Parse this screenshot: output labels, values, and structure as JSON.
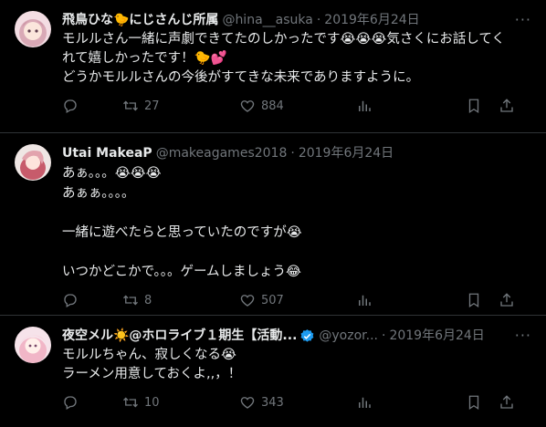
{
  "tweets": [
    {
      "name": "飛鳥ひな🐤にじさんじ所属",
      "handle": "@hina__asuka",
      "dot": "·",
      "date": "2019年6月24日",
      "lines": [
        "モルルさん一緒に声劇できてたのしかったです😭😭😭気さくにお話してく",
        "れて嬉しかったです！🐤💕",
        "どうかモルルさんの今後がすてきな未来でありますように。"
      ],
      "replies": "",
      "retweets": "27",
      "likes": "884",
      "views": ""
    },
    {
      "name": "Utai MakeaP",
      "handle": "@makeagames2018",
      "dot": "·",
      "date": "2019年6月24日",
      "lines": [
        "あぁ。。。😭😭😭",
        "あぁぁ。。。。",
        "",
        "一緒に遊べたらと思っていたのですが😭",
        "",
        "いつかどこかで。。。ゲームしましょう😂"
      ],
      "replies": "",
      "retweets": "8",
      "likes": "507",
      "views": ""
    },
    {
      "name": "夜空メル☀️@ホロライブ１期生【活動...",
      "handle": "@yozor...",
      "dot": "·",
      "date": "2019年6月24日",
      "lines": [
        "モルルちゃん、寂しくなる😭",
        "ラーメン用意しておくよ,,，！"
      ],
      "replies": "",
      "retweets": "10",
      "likes": "343",
      "views": ""
    }
  ],
  "more_label": "···",
  "colors": {
    "bg": "#000000",
    "text": "#e7e9ea",
    "muted": "#71767b",
    "verified": "#1d9bf0",
    "divider": "#2f3336"
  }
}
